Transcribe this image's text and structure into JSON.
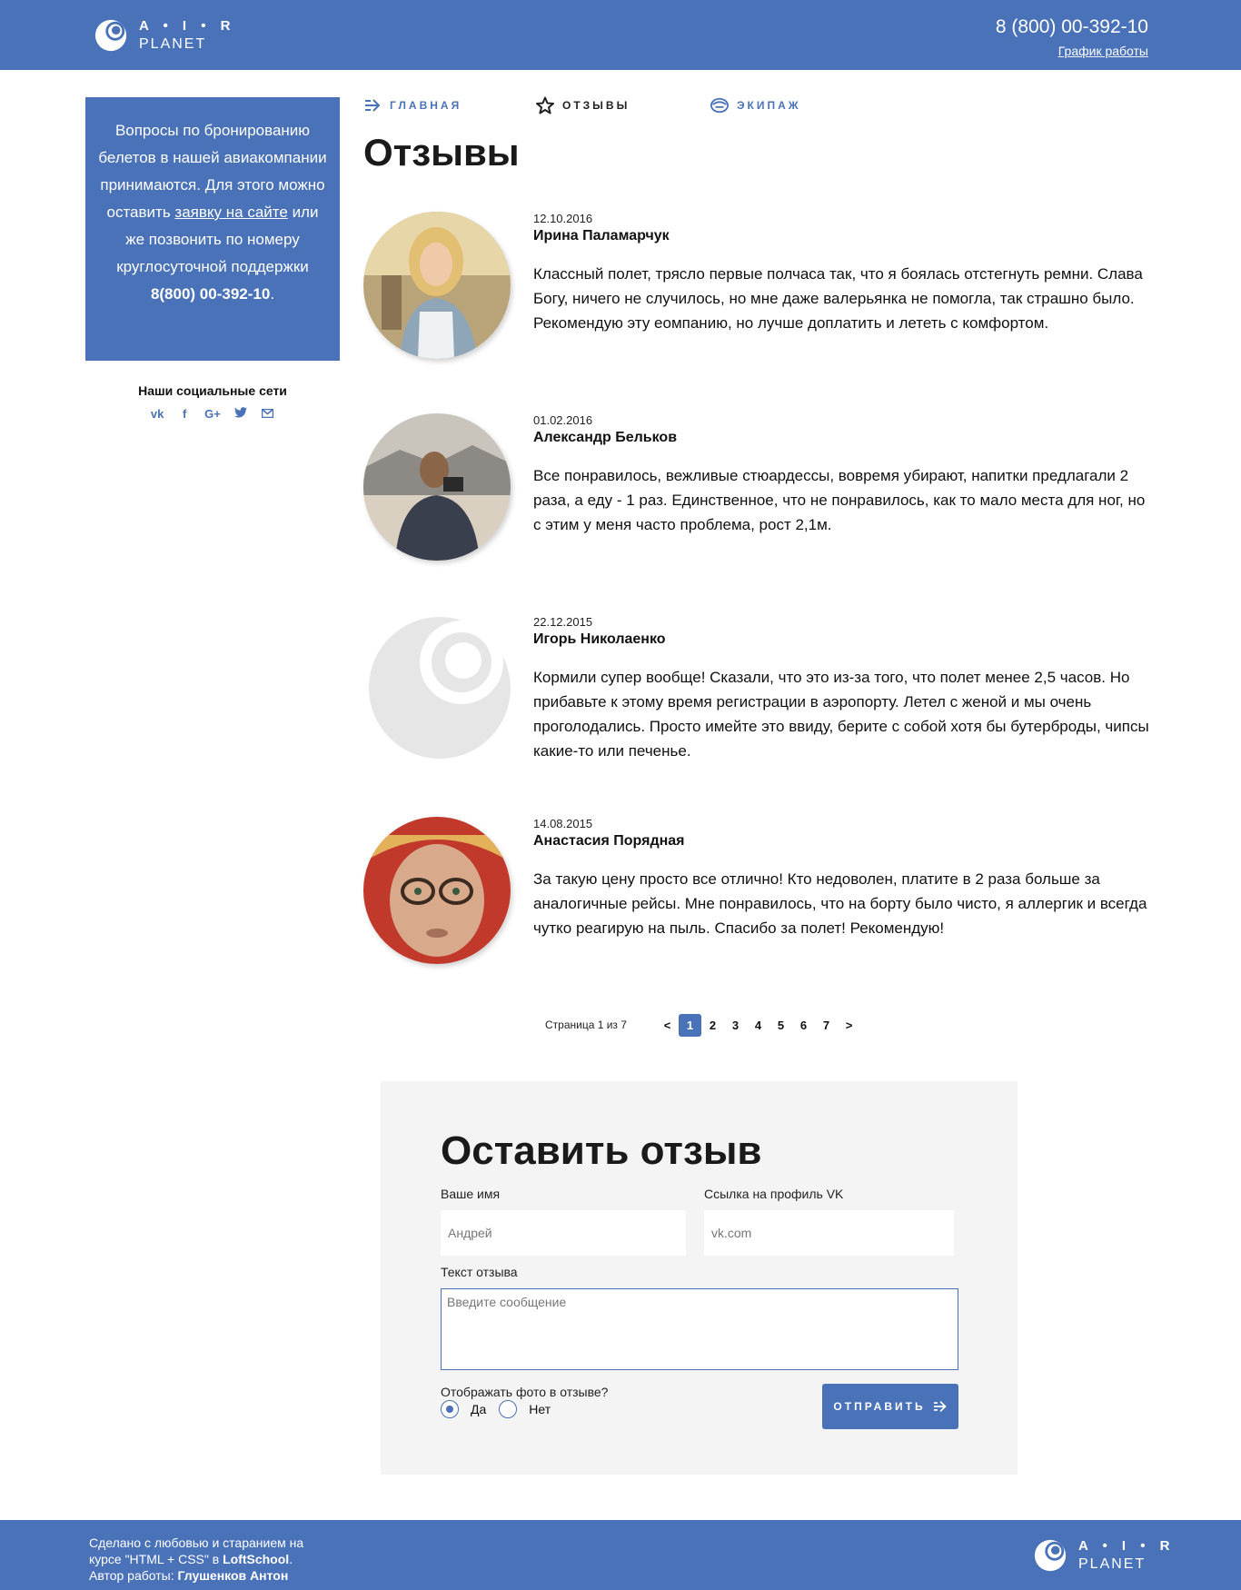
{
  "header": {
    "logo_air": "A • I • R",
    "logo_planet": "PLANET",
    "phone": "8 (800) 00-392-10",
    "schedule_link": "График работы"
  },
  "sidebar": {
    "info_before": "Вопросы по бронированию белетов в нашей авиакомпании принимаются. Для этого можно оставить",
    "info_link": "заявку на сайте",
    "info_middle": "или же позвонить по номеру круглосуточной поддержки",
    "info_phone": "8(800) 00-392-10",
    "info_end": ".",
    "social_title": "Наши социальные сети",
    "social_icons": [
      "vk-icon",
      "facebook-icon",
      "google-plus-icon",
      "twitter-icon",
      "mail-icon"
    ]
  },
  "nav": [
    {
      "label": "ГЛАВНАЯ",
      "icon": "arrow-right-icon",
      "active": false
    },
    {
      "label": "ОТЗЫВЫ",
      "icon": "star-icon",
      "active": true
    },
    {
      "label": "ЭКИПАЖ",
      "icon": "crew-icon",
      "active": false
    }
  ],
  "page_title": "Отзывы",
  "reviews": [
    {
      "date": "12.10.2016",
      "name": "Ирина Паламарчук",
      "text": "Классный полет, трясло первые полчаса так, что я боялась отстегнуть ремни. Слава Богу, ничего не случилось, но мне даже валерьянка не помогла, так страшно было. Рекомендую эту еомпанию, но лучше доплатить и лететь с комфортом.",
      "avatar": "photo-woman"
    },
    {
      "date": "01.02.2016",
      "name": "Александр Бельков",
      "text": "Все понравилось, вежливые стюардессы, вовремя убирают, напитки предлагали 2 раза, а еду - 1 раз. Единственное, что не понравилось, как то мало места для ног, но с этим у меня часто проблема, рост 2,1м.",
      "avatar": "photo-man"
    },
    {
      "date": "22.12.2015",
      "name": "Игорь Николаенко",
      "text": "Кормили супер вообще! Сказали, что это из-за того, что полет менее 2,5 часов. Но прибавьте к этому время регистрации в аэропорту. Летел с женой и мы очень проголодались. Просто имейте это ввиду, берите с собой хотя бы бутерброды, чипсы какие-то или печенье.",
      "avatar": "placeholder-logo"
    },
    {
      "date": "14.08.2015",
      "name": "Анастасия Порядная",
      "text": "За такую цену просто все отлично! Кто недоволен, платите в 2 раза больше за аналогичные рейсы. Мне понравилось, что на борту было чисто, я аллергик и всегда чутко реагирую на пыль. Спасибо за полет! Рекомендую!",
      "avatar": "photo-old-woman"
    }
  ],
  "pagination": {
    "label": "Страница 1 из 7",
    "prev": "<",
    "next": ">",
    "pages": [
      "1",
      "2",
      "3",
      "4",
      "5",
      "6",
      "7"
    ],
    "current": "1"
  },
  "form": {
    "title": "Оставить отзыв",
    "name_label": "Ваше имя",
    "name_placeholder": "Андрей",
    "vk_label": "Ссылка на профиль VK",
    "vk_placeholder": "vk.com",
    "text_label": "Текст отзыва",
    "text_placeholder": "Введите сообщение",
    "photo_question": "Отображать фото в отзыве?",
    "radio_yes": "Да",
    "radio_no": "Нет",
    "radio_selected": "Да",
    "submit_label": "ОТПРАВИТЬ"
  },
  "footer": {
    "line1": "Сделано с любовью и старанием на",
    "line2_prefix": "курсе \"HTML + CSS\" в ",
    "line2_school": "LoftSchool",
    "line2_suffix": ".",
    "line3_prefix": "Автор работы: ",
    "line3_author": "Глушенков Антон"
  },
  "colors": {
    "brand": "#4a72b8",
    "form_bg": "#f4f4f4"
  }
}
